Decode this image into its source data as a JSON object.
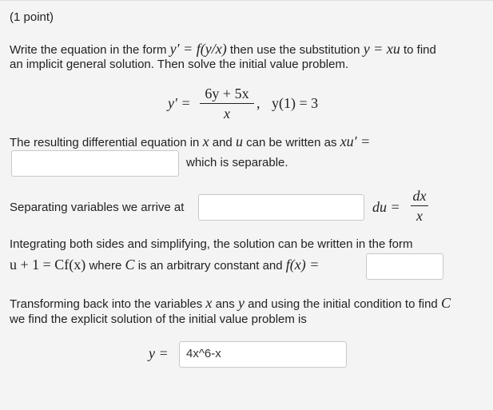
{
  "header": {
    "points": "(1 point)"
  },
  "intro": {
    "line1_a": "Write the equation in the form",
    "line1_form": "y′ = f(y/x)",
    "line1_b": "then use the substitution",
    "line1_sub": "y = xu",
    "line1_c": "to find",
    "line2": "an implicit general solution. Then solve the initial value problem."
  },
  "equation": {
    "lhs": "y′ =",
    "numerator": "6y + 5x",
    "denominator": "x",
    "comma": ",",
    "ic": "y(1) = 3"
  },
  "step1": {
    "text_a": "The resulting differential equation in",
    "x": "x",
    "and": "and",
    "u": "u",
    "text_b": "can be written as",
    "expr": "xu′ =",
    "input_value": "",
    "after": "which is separable."
  },
  "step2": {
    "text": "Separating variables we arrive at",
    "input_value": "",
    "du": "du =",
    "frac_num": "dx",
    "frac_den": "x"
  },
  "step3": {
    "line1": "Integrating both sides and simplifying, the solution can be written in the form",
    "form": "u + 1 = Cf(x)",
    "where": "where",
    "C": "C",
    "text_b": "is an arbitrary constant and",
    "fx": "f(x) =",
    "input_value": ""
  },
  "step4": {
    "line1_a": "Transforming back into the variables",
    "x": "x",
    "ans": "ans",
    "y": "y",
    "line1_b": "and using the initial condition to find",
    "C": "C",
    "line2": "we find the explicit solution of the initial value problem is",
    "y_label": "y =",
    "input_value": "4x^6-x"
  }
}
